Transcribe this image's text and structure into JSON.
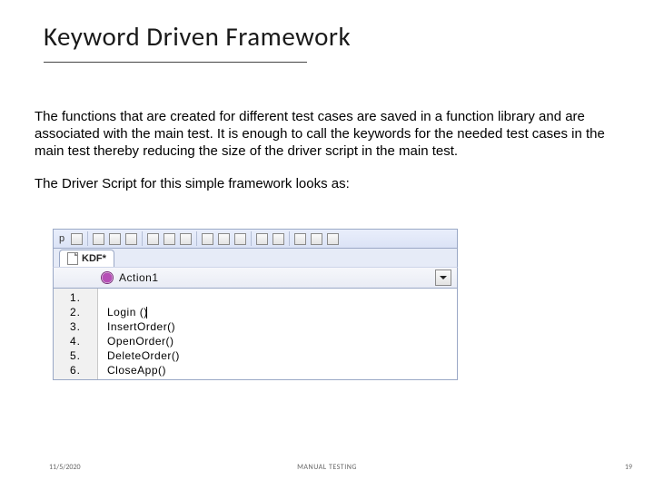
{
  "title": "Keyword Driven Framework",
  "body": {
    "para1": "The functions that are created for different test cases are saved in a function library and are associated with the main test. It is enough to call the keywords for the needed test cases in the main test thereby reducing the size of the driver script in the main test.",
    "para2": "The Driver Script for this simple framework looks as:"
  },
  "ide": {
    "toolbar_prefix_text": "p",
    "tab_label": "KDF*",
    "action_label": "Action1",
    "gutter": [
      "1.",
      "2.",
      "3.",
      "4.",
      "5.",
      "6."
    ],
    "code_lines": [
      "Login ()",
      "InsertOrder()",
      "OpenOrder()",
      "DeleteOrder()",
      "CloseApp()",
      ""
    ]
  },
  "footer": {
    "date": "11/5/2020",
    "center": "MANUAL TESTING",
    "page": "19"
  }
}
